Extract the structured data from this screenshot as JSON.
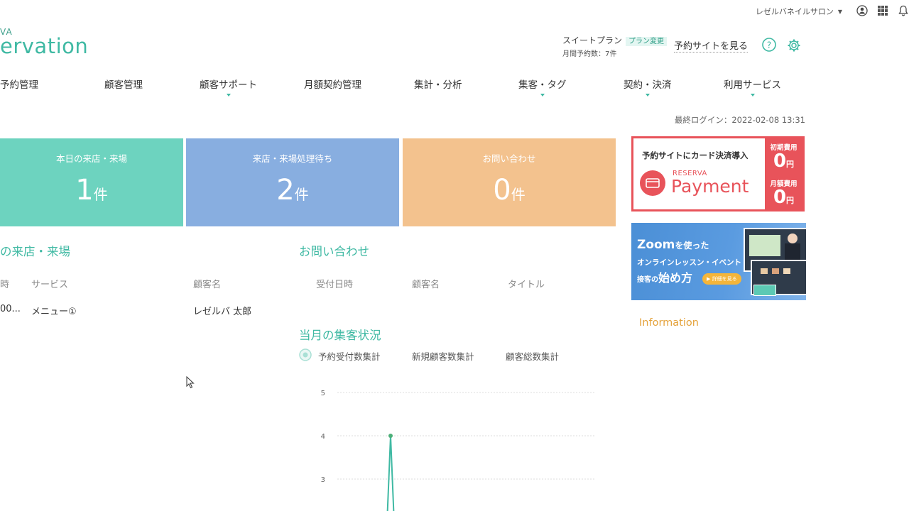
{
  "header": {
    "account_name": "レゼルバネイルサロン",
    "logo_small": "VA",
    "logo_big": "ervation",
    "plan_name": "スイートプラン",
    "plan_change": "プラン変更",
    "monthly_reservations": "月間予約数：7件",
    "view_site": "予約サイトを見る"
  },
  "nav": [
    "予約管理",
    "顧客管理",
    "顧客サポート",
    "月額契約管理",
    "集計・分析",
    "集客・タグ",
    "契約・決済",
    "利用サービス"
  ],
  "last_login": "最終ログイン：2022-02-08 13:31",
  "cards": [
    {
      "label": "本日の来店・来場",
      "value": "1",
      "unit": "件",
      "color": "#6dd3bf"
    },
    {
      "label": "来店・来場処理待ち",
      "value": "2",
      "unit": "件",
      "color": "#88aee0"
    },
    {
      "label": "お問い合わせ",
      "value": "0",
      "unit": "件",
      "color": "#f3c28e"
    }
  ],
  "visits": {
    "title": "の来店・来場",
    "columns": [
      "時",
      "サービス",
      "顧客名"
    ],
    "rows": [
      {
        "time": "00...",
        "service": "メニュー①",
        "customer": "レゼルバ 太郎"
      }
    ]
  },
  "inquiries": {
    "title": "お問い合わせ",
    "columns": [
      "受付日時",
      "顧客名",
      "タイトル"
    ]
  },
  "stats": {
    "title": "当月の集客状況",
    "tabs": [
      "予約受付数集計",
      "新規顧客数集計",
      "顧客総数集計"
    ]
  },
  "chart_data": {
    "type": "line",
    "yticks": [
      5,
      4,
      3
    ],
    "ylim": [
      3,
      5
    ],
    "series": [
      {
        "values": [
          {
            "x": 0,
            "y": 2
          },
          {
            "x": 1,
            "y": 4
          },
          {
            "x": 2,
            "y": 2
          }
        ]
      }
    ],
    "color": "#3fb9a3"
  },
  "payment_banner": {
    "headline": "予約サイトにカード決済導入",
    "brand_small": "RESERVA",
    "brand_big": "Payment",
    "initial_label": "初期費用",
    "initial_value": "0",
    "monthly_label": "月額費用",
    "monthly_value": "0",
    "yen": "円"
  },
  "zoom_banner": {
    "line1_a": "Zoom",
    "line1_b": "を使った",
    "line2": "オンラインレッスン・イベント・",
    "line3_a": "接客の",
    "line3_b": "始め方",
    "button": "▶ 詳細を見る"
  },
  "info_title": "Information",
  "colors": {
    "accent": "#3fb9a3",
    "payment": "#e8535a",
    "zoom": "#4b8fd6",
    "info": "#e4a23b"
  }
}
